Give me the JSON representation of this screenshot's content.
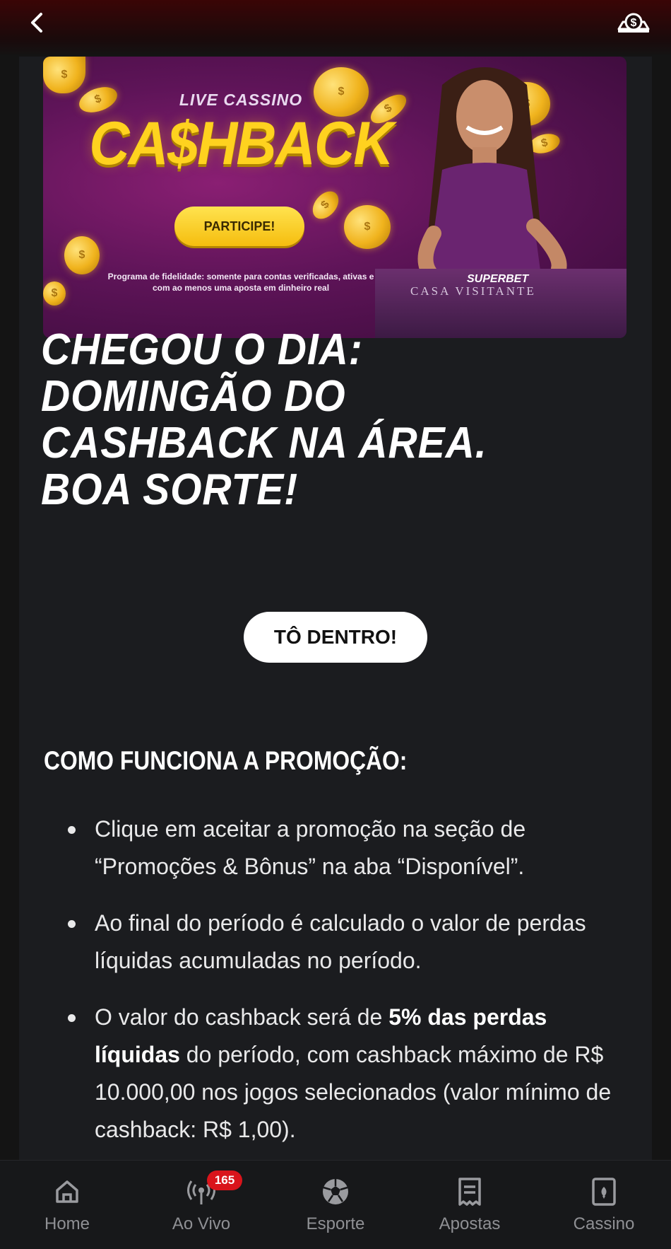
{
  "header": {
    "back_icon": "chevron-left-icon",
    "wallet_icon": "wallet-dollar-icon"
  },
  "banner": {
    "eyebrow": "LIVE CASSINO",
    "title": "CA$HBACK",
    "cta": "PARTICIPE!",
    "fine_print": "Programa de fidelidade: somente para contas verificadas, ativas e com ao menos uma aposta em dinheiro real",
    "table_brand": "SUPERBET",
    "table_text": "CASA   VISITANTE"
  },
  "promo": {
    "headline": "CHEGOU O DIA: DOMINGÃO DO CASHBACK NA ÁREA. BOA SORTE!",
    "join_button": "TÔ DENTRO!",
    "section_title": "COMO FUNCIONA A PROMOÇÃO:",
    "rules": [
      {
        "text": "Clique em aceitar a promoção na seção de “Promoções & Bônus” na aba “Disponível”."
      },
      {
        "text": "Ao final do período é calculado o valor de perdas líquidas acumuladas no período."
      },
      {
        "pre": "O valor do cashback será de ",
        "bold": "5% das perdas líquidas",
        "post": " do período, com cashback máximo de R$ 10.000,00 nos jogos selecionados (valor mínimo de cashback: R$ 1,00)."
      }
    ]
  },
  "bottom_nav": {
    "items": [
      {
        "label": "Home",
        "icon": "home-icon"
      },
      {
        "label": "Ao Vivo",
        "icon": "live-broadcast-icon",
        "badge": "165"
      },
      {
        "label": "Esporte",
        "icon": "soccer-ball-icon"
      },
      {
        "label": "Apostas",
        "icon": "bet-slip-icon"
      },
      {
        "label": "Cassino",
        "icon": "playing-card-icon"
      }
    ]
  },
  "colors": {
    "background": "#141414",
    "panel": "#1b1c1f",
    "accent_yellow": "#ffd21f",
    "badge_red": "#d9141b"
  }
}
